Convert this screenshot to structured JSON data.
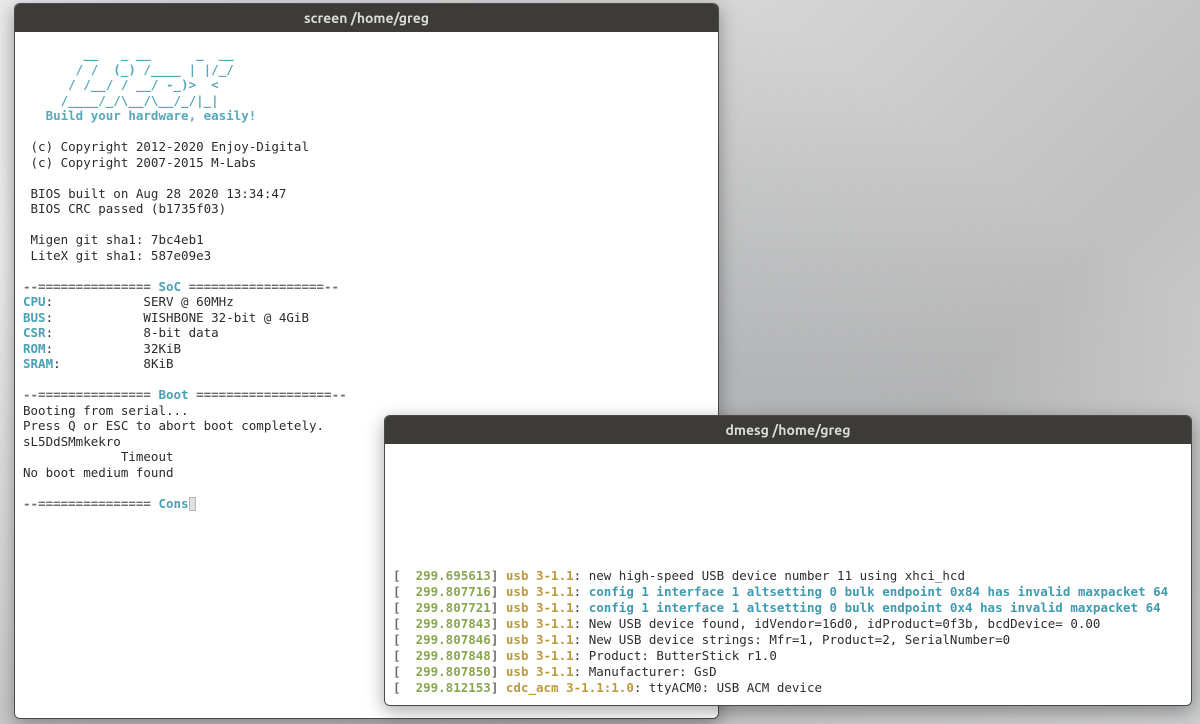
{
  "windows": {
    "screen": {
      "title": "screen /home/greg",
      "ascii": [
        "        __   _ __      _  __",
        "       / /  (_) /____ | |/_/",
        "      / /__/ / __/ -_)>  <",
        "     /____/_/\\__/\\__/_/|_|",
        "   Build your hardware, easily!"
      ],
      "copyright": [
        " (c) Copyright 2012-2020 Enjoy-Digital",
        " (c) Copyright 2007-2015 M-Labs"
      ],
      "bios_built": " BIOS built on Aug 28 2020 13:34:47",
      "bios_crc": " BIOS CRC passed (b1735f03)",
      "migen_sha": " Migen git sha1: 7bc4eb1",
      "litex_sha": " LiteX git sha1: 587e09e3",
      "div_left": "--=============== ",
      "div_right_soc": " ==================--",
      "div_right_boot": " ==================--",
      "div_right_cons": "",
      "labels": {
        "soc": "SoC",
        "boot": "Boot",
        "cons": "Cons"
      },
      "soc": {
        "cpu_label": "CPU",
        "cpu_val": "SERV @ 60MHz",
        "bus_label": "BUS",
        "bus_val": "WISHBONE 32-bit @ 4GiB",
        "csr_label": "CSR",
        "csr_val": "8-bit data",
        "rom_label": "ROM",
        "rom_val": "32KiB",
        "sram_label": "SRAM",
        "sram_val": "8KiB"
      },
      "boot": {
        "l1": "Booting from serial...",
        "l2": "Press Q or ESC to abort boot completely.",
        "l3": "sL5DdSMmkekro",
        "l4": "             Timeout",
        "l5": "No boot medium found"
      }
    },
    "dmesg": {
      "title": "dmesg /home/greg",
      "lines": [
        {
          "ts": "299.695613",
          "tag": "usb 3-1.1",
          "msg": "new high-speed USB device number 11 using xhci_hcd",
          "warn": false
        },
        {
          "ts": "299.807716",
          "tag": "usb 3-1.1",
          "msg": "config 1 interface 1 altsetting 0 bulk endpoint 0x84 has invalid maxpacket 64",
          "warn": true
        },
        {
          "ts": "299.807721",
          "tag": "usb 3-1.1",
          "msg": "config 1 interface 1 altsetting 0 bulk endpoint 0x4 has invalid maxpacket 64",
          "warn": true
        },
        {
          "ts": "299.807843",
          "tag": "usb 3-1.1",
          "msg": "New USB device found, idVendor=16d0, idProduct=0f3b, bcdDevice= 0.00",
          "warn": false
        },
        {
          "ts": "299.807846",
          "tag": "usb 3-1.1",
          "msg": "New USB device strings: Mfr=1, Product=2, SerialNumber=0",
          "warn": false
        },
        {
          "ts": "299.807848",
          "tag": "usb 3-1.1",
          "msg": "Product: ButterStick r1.0",
          "warn": false
        },
        {
          "ts": "299.807850",
          "tag": "usb 3-1.1",
          "msg": "Manufacturer: GsD",
          "warn": false
        },
        {
          "ts": "299.812153",
          "tag": "cdc_acm 3-1.1:1.0",
          "msg": "ttyACM0: USB ACM device",
          "warn": false
        }
      ]
    }
  }
}
